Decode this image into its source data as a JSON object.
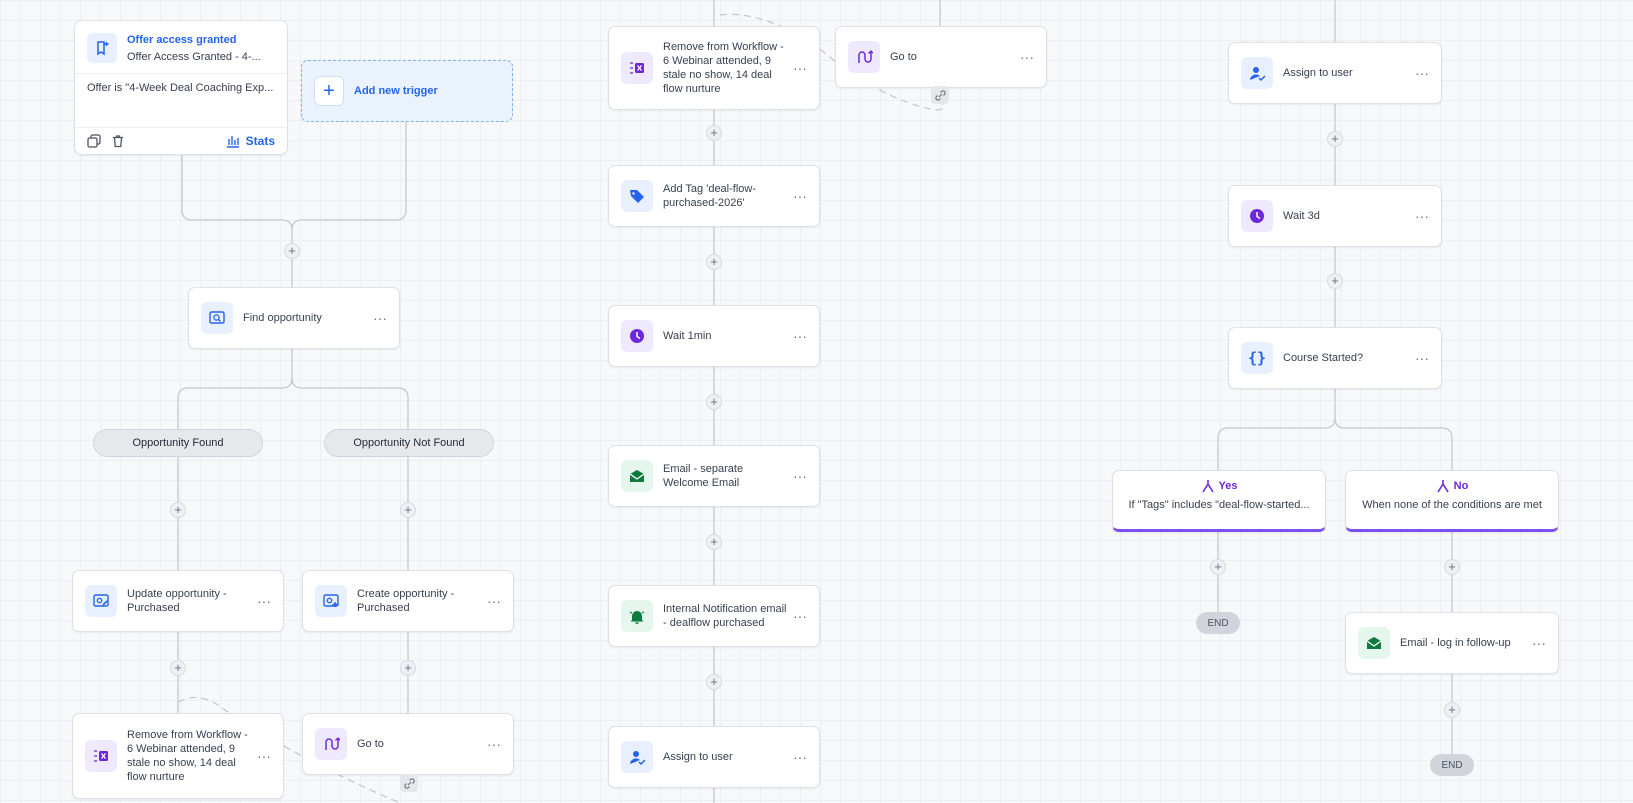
{
  "trigger": {
    "title": "Offer access granted",
    "subtitle": "Offer Access Granted - 4-...",
    "filter": "Offer is \"4-Week Deal Coaching Exp...",
    "stats_label": "Stats",
    "add_label": "Add new trigger"
  },
  "col1": {
    "find": "Find opportunity",
    "found": "Opportunity Found",
    "not_found": "Opportunity Not Found",
    "update": "Update opportunity - Purchased",
    "create": "Create opportunity - Purchased",
    "remove": "Remove from Workflow - 6 Webinar attended, 9 stale no show, 14 deal flow nurture",
    "goto": "Go to"
  },
  "col2": {
    "remove": "Remove from Workflow - 6 Webinar attended, 9 stale no show, 14 deal flow nurture",
    "goto": "Go to",
    "tag": "Add Tag 'deal-flow-purchased-2026'",
    "wait": "Wait 1min",
    "email": "Email - separate Welcome Email",
    "notify": "Internal Notification email - dealflow purchased",
    "assign": "Assign to user"
  },
  "col3": {
    "assign": "Assign to user",
    "wait": "Wait 3d",
    "condition": "Course Started?",
    "yes_title": "Yes",
    "yes_desc": "If \"Tags\" includes \"deal-flow-started...",
    "no_title": "No",
    "no_desc": "When none of the conditions are met",
    "email": "Email - log in follow-up",
    "end": "END"
  },
  "ui": {
    "dots": "···",
    "plus": "+"
  }
}
